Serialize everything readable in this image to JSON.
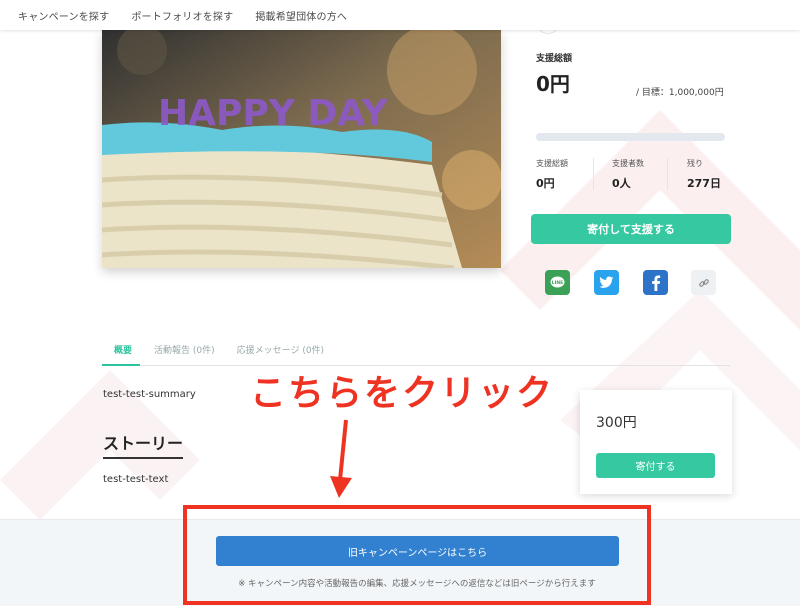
{
  "nav": {
    "items": [
      "キャンペーンを探す",
      "ポートフォリオを探す",
      "掲載希望団体の方へ"
    ]
  },
  "hero": {
    "candle_text": "HAPPY DAY"
  },
  "funding": {
    "total_label": "支援総額",
    "total_value": "0円",
    "goal_text": "/ 目標：1,000,000円",
    "progress": 0,
    "stats": [
      {
        "label": "支援総額",
        "value": "0円"
      },
      {
        "label": "支援者数",
        "value": "0人"
      },
      {
        "label": "残り",
        "value": "277日"
      }
    ],
    "donate_button": "寄付して支援する"
  },
  "share": {
    "line_label": "LINE",
    "buttons": [
      {
        "icon": "line-icon",
        "color": "#3aa156"
      },
      {
        "icon": "twitter-icon",
        "color": "#2aa3ef"
      },
      {
        "icon": "facebook-icon",
        "color": "#2d73c7"
      },
      {
        "icon": "link-icon",
        "color": "#eef1f4"
      }
    ]
  },
  "tabs": [
    {
      "label": "概要",
      "active": true
    },
    {
      "label": "活動報告 (0件)",
      "active": false
    },
    {
      "label": "応援メッセージ (0件)",
      "active": false
    }
  ],
  "content": {
    "summary": "test-test-summary",
    "story_heading": "ストーリー",
    "story_text": "test-test-text"
  },
  "reward": {
    "price": "300円",
    "button": "寄付する"
  },
  "annotation": {
    "text": "こちらをクリック",
    "color": "#ee3323"
  },
  "footer": {
    "old_page_button": "旧キャンペーンページはこちら",
    "note": "※ キャンペーン内容や活動報告の編集、応援メッセージへの返信などは旧ページから行えます"
  },
  "colors": {
    "accent": "#36c9a1",
    "blue": "#3281d0",
    "annotation_red": "#ee3323"
  }
}
